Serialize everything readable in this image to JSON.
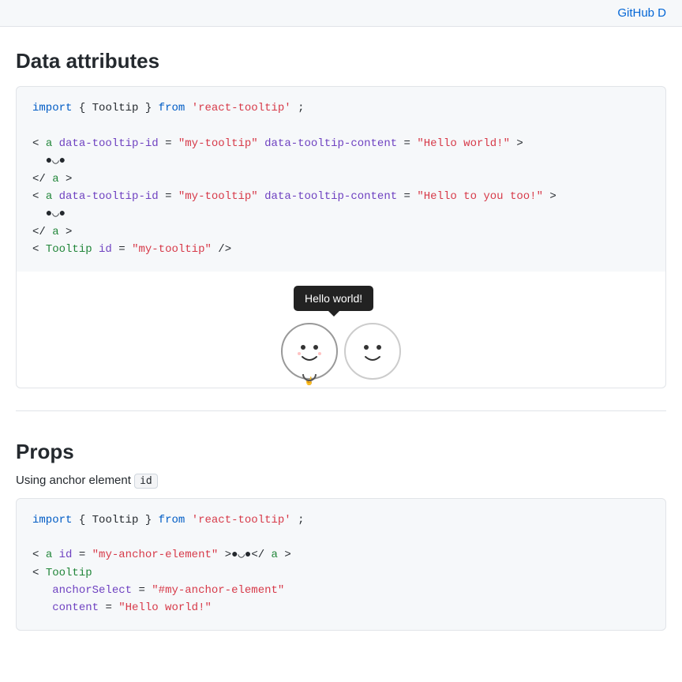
{
  "header": {
    "github_label": "GitHub D"
  },
  "data_attributes_section": {
    "heading": "Data attributes",
    "code_lines": [
      {
        "type": "import",
        "text": "import { Tooltip } from 'react-tooltip';"
      },
      {
        "type": "blank"
      },
      {
        "type": "tag_open",
        "text": "<a data-tooltip-id=\"my-tooltip\" data-tooltip-content=\"Hello world!\">"
      },
      {
        "type": "content",
        "text": "  ●◡●"
      },
      {
        "type": "tag_close",
        "text": "</a>"
      },
      {
        "type": "tag_open2",
        "text": "<a data-tooltip-id=\"my-tooltip\" data-tooltip-content=\"Hello to you too!\">"
      },
      {
        "type": "content",
        "text": "  ●◡●"
      },
      {
        "type": "tag_close",
        "text": "</a>"
      },
      {
        "type": "self_close",
        "text": "<Tooltip id=\"my-tooltip\" />"
      }
    ],
    "tooltip_text": "Hello world!",
    "face1": "( ͡° ͜ʖ ͡°)",
    "face2": "( ͡° ͜ʖ ͡°)"
  },
  "props_section": {
    "heading": "Props",
    "anchor_id_label": "Using anchor element",
    "anchor_id_code": "id",
    "code_lines": [
      {
        "type": "import",
        "text": "import { Tooltip } from 'react-tooltip';"
      },
      {
        "type": "blank"
      },
      {
        "type": "tag_open_a",
        "text": "<a id=\"my-anchor-element\">●◡●</a>"
      },
      {
        "type": "tooltip_open",
        "text": "<Tooltip"
      },
      {
        "type": "attr_line",
        "text": "  anchorSelect=\"#my-anchor-element\""
      },
      {
        "type": "attr_line2",
        "text": "  content=\"Hello world!\""
      }
    ]
  }
}
